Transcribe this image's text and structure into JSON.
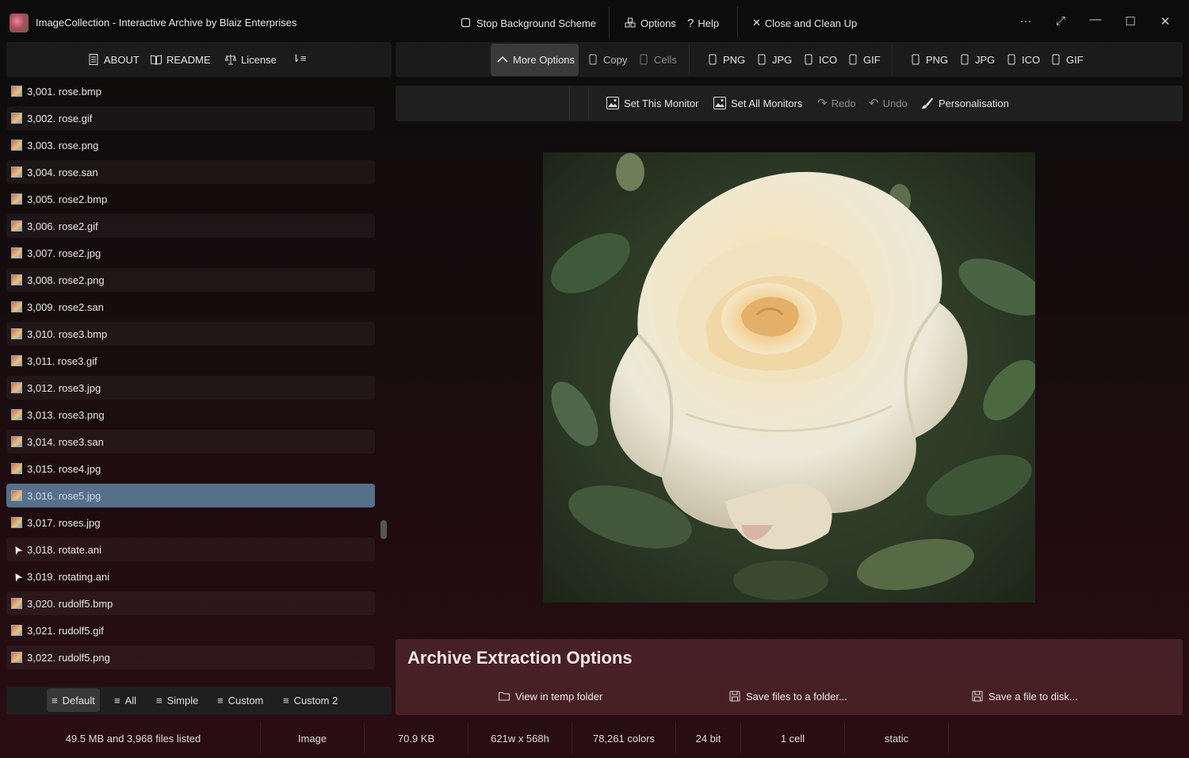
{
  "app": {
    "title": "ImageCollection  -  Interactive Archive by Blaiz Enterprises",
    "stop_background": "Stop Background Scheme",
    "options": "Options",
    "help": "Help",
    "close_clean": "Close and Clean Up",
    "more_icon": "···",
    "expand_icon": "⤢",
    "minimize_icon": "—",
    "maximize_icon": "☐",
    "close_icon": "✕"
  },
  "left_toolbar": {
    "about": "ABOUT",
    "readme": "README",
    "license": "License",
    "sort_icon": "⇂≡"
  },
  "right_toolbar": {
    "more_options": "More Options",
    "copy": "Copy",
    "cells": "Cells",
    "group1": [
      "PNG",
      "JPG",
      "ICO",
      "GIF"
    ],
    "group2": [
      "PNG",
      "JPG",
      "ICO",
      "GIF"
    ]
  },
  "secondary_toolbar": {
    "set_this_monitor": "Set This Monitor",
    "set_all_monitors": "Set All Monitors",
    "redo": "Redo",
    "undo": "Undo",
    "personalisation": "Personalisation"
  },
  "file_list": [
    {
      "label": "3,001.  rose.bmp",
      "type": "image",
      "selected": false
    },
    {
      "label": "3,002.  rose.gif",
      "type": "image",
      "selected": false
    },
    {
      "label": "3,003.  rose.png",
      "type": "image",
      "selected": false
    },
    {
      "label": "3,004.  rose.san",
      "type": "image",
      "selected": false
    },
    {
      "label": "3,005.  rose2.bmp",
      "type": "image",
      "selected": false
    },
    {
      "label": "3,006.  rose2.gif",
      "type": "image",
      "selected": false
    },
    {
      "label": "3,007.  rose2.jpg",
      "type": "image",
      "selected": false
    },
    {
      "label": "3,008.  rose2.png",
      "type": "image",
      "selected": false
    },
    {
      "label": "3,009.  rose2.san",
      "type": "image",
      "selected": false
    },
    {
      "label": "3,010.  rose3.bmp",
      "type": "image",
      "selected": false
    },
    {
      "label": "3,011.  rose3.gif",
      "type": "image",
      "selected": false
    },
    {
      "label": "3,012.  rose3.jpg",
      "type": "image",
      "selected": false
    },
    {
      "label": "3,013.  rose3.png",
      "type": "image",
      "selected": false
    },
    {
      "label": "3,014.  rose3.san",
      "type": "image",
      "selected": false
    },
    {
      "label": "3,015.  rose4.jpg",
      "type": "image",
      "selected": false
    },
    {
      "label": "3,016.  rose5.jpg",
      "type": "image",
      "selected": true
    },
    {
      "label": "3,017.  roses.jpg",
      "type": "image",
      "selected": false
    },
    {
      "label": "3,018.  rotate.ani",
      "type": "cursor",
      "selected": false
    },
    {
      "label": "3,019.  rotating.ani",
      "type": "cursor",
      "selected": false
    },
    {
      "label": "3,020.  rudolf5.bmp",
      "type": "image",
      "selected": false
    },
    {
      "label": "3,021.  rudolf5.gif",
      "type": "image",
      "selected": false
    },
    {
      "label": "3,022.  rudolf5.png",
      "type": "image",
      "selected": false
    }
  ],
  "view_modes": {
    "default": "Default",
    "all": "All",
    "simple": "Simple",
    "custom": "Custom",
    "custom2": "Custom 2"
  },
  "preview": {
    "subject": "white-rose-photo"
  },
  "extraction": {
    "title": "Archive Extraction Options",
    "view_temp": "View in temp folder",
    "save_folder": "Save files to a folder...",
    "save_disk": "Save a file to disk..."
  },
  "status": {
    "files": "49.5 MB and 3,968 files listed",
    "kind": "Image",
    "size": "70.9 KB",
    "dimensions": "621w x 568h",
    "colors": "78,261 colors",
    "bits": "24 bit",
    "cells": "1 cell",
    "mode": "static"
  }
}
